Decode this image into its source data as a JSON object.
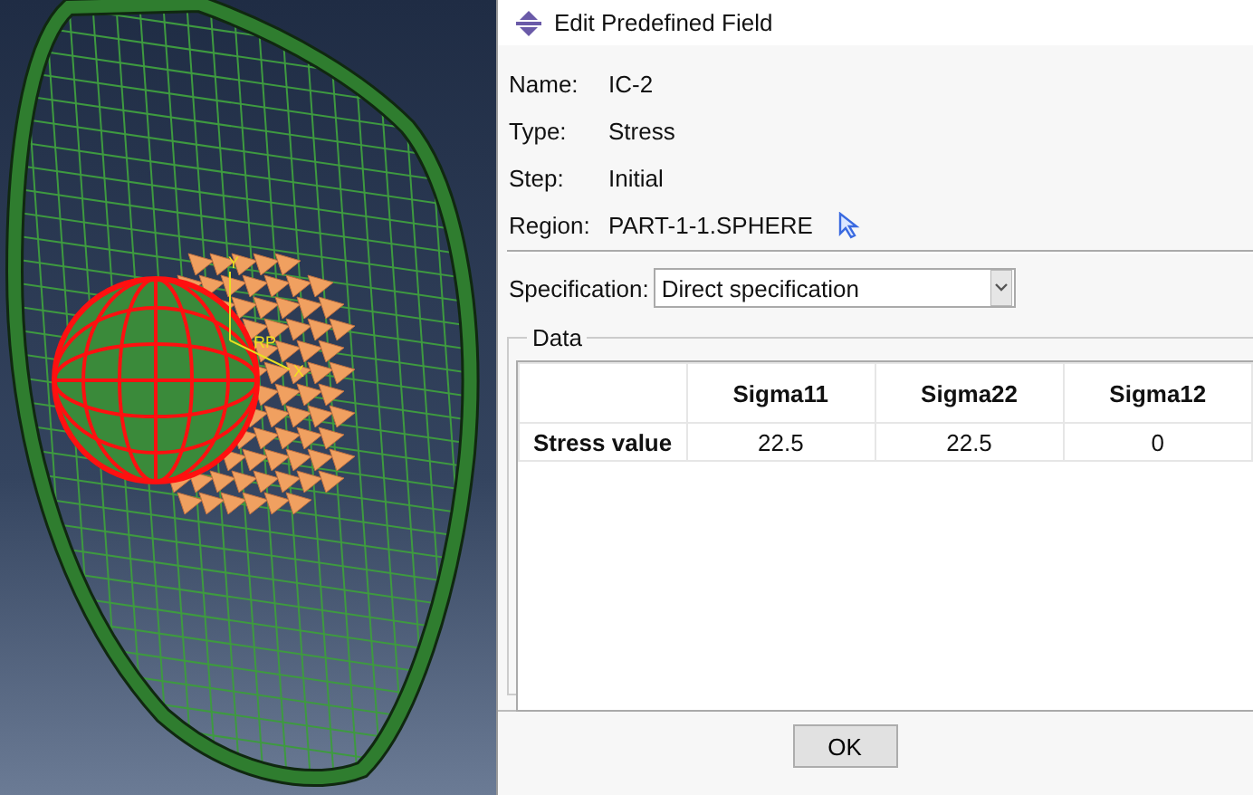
{
  "viewport": {
    "axis_labels": [
      "Y",
      "RP",
      "X"
    ]
  },
  "dialog": {
    "title": "Edit Predefined Field",
    "fields": [
      {
        "label": "Name:",
        "value": "IC-2",
        "kind": "text"
      },
      {
        "label": "Type:",
        "value": "Stress",
        "kind": "text"
      },
      {
        "label": "Step:",
        "value": "Initial",
        "kind": "text"
      },
      {
        "label": "Region:",
        "value": "PART-1-1.SPHERE",
        "kind": "region"
      }
    ],
    "specification": {
      "label": "Specification:",
      "value": "Direct specification"
    },
    "data": {
      "label": "Data",
      "columns": [
        "Sigma11",
        "Sigma22",
        "Sigma12"
      ],
      "rows": [
        {
          "label": "Stress value",
          "cells": [
            "22.5",
            "22.5",
            "0"
          ]
        }
      ]
    },
    "buttons": [
      "OK"
    ]
  }
}
